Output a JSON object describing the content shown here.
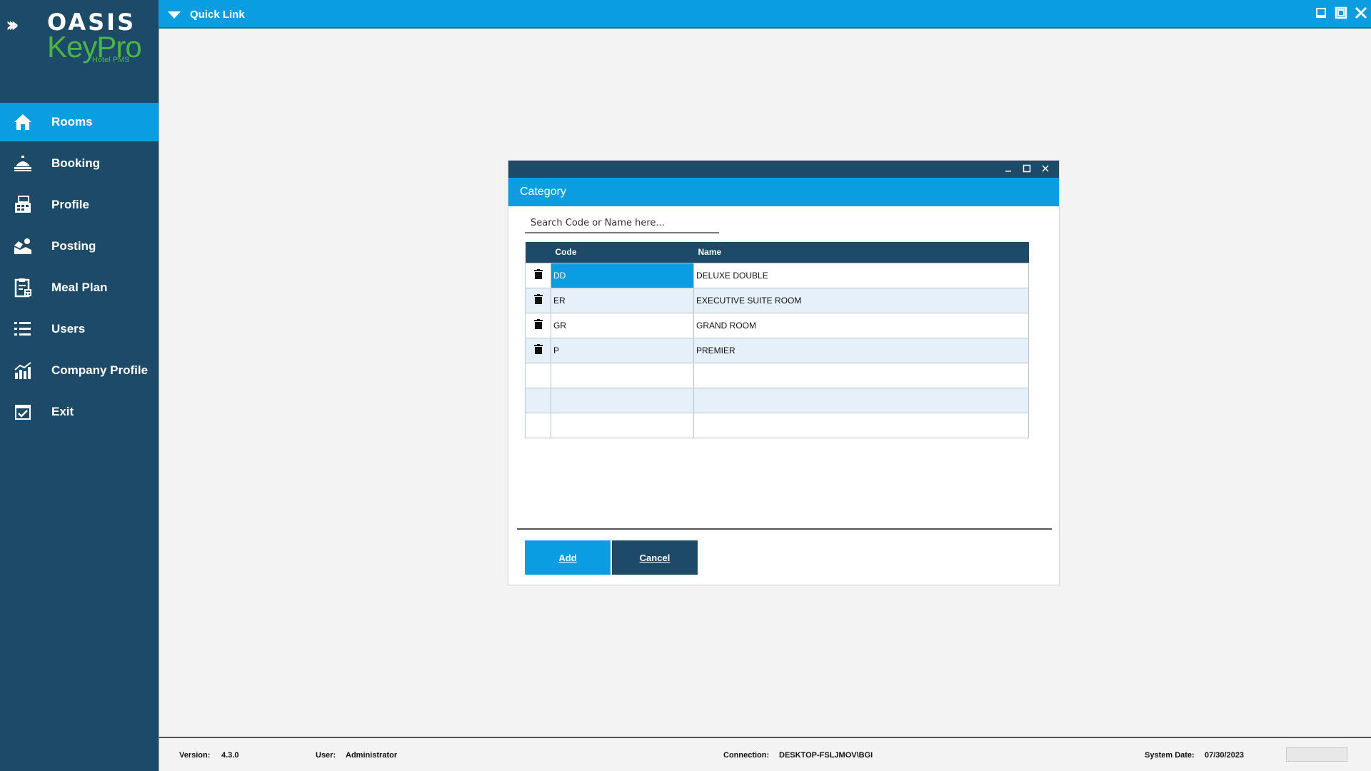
{
  "app": {
    "logo_text": "OASIS",
    "logo_product": "KeyPro",
    "logo_sub": "Hotel PMS"
  },
  "sidebar": {
    "items": [
      {
        "label": "Rooms",
        "icon": "home-icon",
        "active": true
      },
      {
        "label": "Booking",
        "icon": "bell-icon"
      },
      {
        "label": "Profile",
        "icon": "profile-card-icon"
      },
      {
        "label": "Posting",
        "icon": "posting-icon"
      },
      {
        "label": "Meal Plan",
        "icon": "clipboard-icon"
      },
      {
        "label": "Users",
        "icon": "list-icon"
      },
      {
        "label": "Company Profile",
        "icon": "chart-icon"
      },
      {
        "label": "Exit",
        "icon": "calendar-check-icon"
      }
    ]
  },
  "topbar": {
    "title": "Quick Link"
  },
  "dialog": {
    "header": "Category",
    "search_placeholder": "Search Code or Name here...",
    "columns": {
      "code": "Code",
      "name": "Name"
    },
    "rows": [
      {
        "code": "DD",
        "name": "DELUXE DOUBLE"
      },
      {
        "code": "ER",
        "name": "EXECUTIVE SUITE ROOM"
      },
      {
        "code": "GR",
        "name": "GRAND ROOM"
      },
      {
        "code": "P",
        "name": "PREMIER"
      },
      {
        "code": "",
        "name": ""
      },
      {
        "code": "",
        "name": ""
      },
      {
        "code": "",
        "name": ""
      }
    ],
    "add_label": "Add",
    "cancel_label": "Cancel"
  },
  "status": {
    "version_label": "Version:",
    "version": "4.3.0",
    "user_label": "User:",
    "user": "Administrator",
    "connection_label": "Connection:",
    "connection": "DESKTOP-FSLJMOV\\BGI",
    "date_label": "System Date:",
    "date": "07/30/2023"
  },
  "colors": {
    "sidebar": "#1d4a66",
    "accent": "#0a9ee1",
    "logo_green": "#49b548"
  }
}
